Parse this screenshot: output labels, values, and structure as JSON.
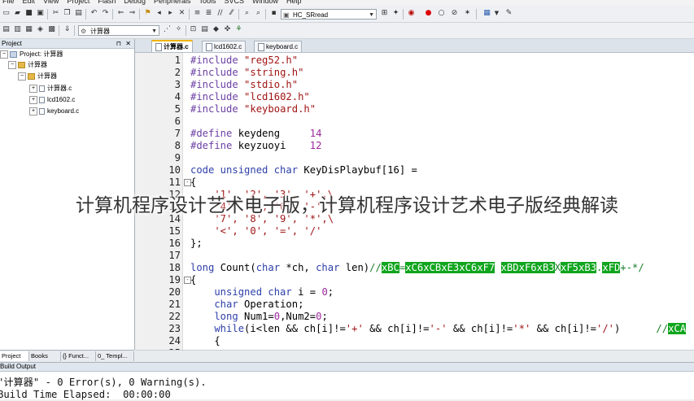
{
  "menu": [
    "File",
    "Edit",
    "View",
    "Project",
    "Flash",
    "Debug",
    "Peripherals",
    "Tools",
    "SVCS",
    "Window",
    "Help"
  ],
  "toolbar": {
    "target_combo": "HC_SRread",
    "target_select": "计算器"
  },
  "project_panel": {
    "title": "Project",
    "root": "Project: 计算器",
    "target": "计算器",
    "group": "计算器",
    "files": [
      "计算器.c",
      "lcd1602.c",
      "keyboard.c"
    ],
    "tabs": [
      "Project",
      "Books",
      "{} Funct...",
      "0_ Templ..."
    ]
  },
  "editor": {
    "tabs": [
      "计算器.c",
      "lcd1602.c",
      "keyboard.c"
    ],
    "active_tab": 0,
    "lines": [
      {
        "n": "1",
        "t": [
          [
            "pp",
            "#include "
          ],
          [
            "s",
            "\"reg52.h\""
          ]
        ]
      },
      {
        "n": "2",
        "t": [
          [
            "pp",
            "#include "
          ],
          [
            "s",
            "\"string.h\""
          ]
        ]
      },
      {
        "n": "3",
        "t": [
          [
            "pp",
            "#include "
          ],
          [
            "s",
            "\"stdio.h\""
          ]
        ]
      },
      {
        "n": "4",
        "t": [
          [
            "pp",
            "#include "
          ],
          [
            "s",
            "\"lcd1602.h\""
          ]
        ]
      },
      {
        "n": "5",
        "t": [
          [
            "pp",
            "#include "
          ],
          [
            "s",
            "\"keyboard.h\""
          ]
        ]
      },
      {
        "n": "6",
        "t": []
      },
      {
        "n": "7",
        "t": [
          [
            "pp",
            "#define "
          ],
          [
            "",
            "keydeng     "
          ],
          [
            "n",
            "14"
          ]
        ]
      },
      {
        "n": "8",
        "t": [
          [
            "pp",
            "#define "
          ],
          [
            "",
            "keyzuoyi    "
          ],
          [
            "n",
            "12"
          ]
        ]
      },
      {
        "n": "9",
        "t": []
      },
      {
        "n": "10",
        "t": [
          [
            "k",
            "code unsigned char "
          ],
          [
            "",
            "KeyDisPlaybuf[16] ="
          ]
        ]
      },
      {
        "n": "11",
        "fold": "-",
        "t": [
          [
            "",
            "{"
          ]
        ]
      },
      {
        "n": "12",
        "t": [
          [
            "s",
            "    '1', '2', '3', '+',\\"
          ]
        ]
      },
      {
        "n": "13",
        "t": [
          [
            "s",
            "    '4', '5', '6', '-',\\"
          ]
        ]
      },
      {
        "n": "14",
        "t": [
          [
            "s",
            "    '7', '8', '9', '*',\\"
          ]
        ]
      },
      {
        "n": "15",
        "t": [
          [
            "s",
            "    '<', '0', '=', '/'"
          ]
        ]
      },
      {
        "n": "16",
        "t": [
          [
            "",
            "};"
          ]
        ]
      },
      {
        "n": "17",
        "t": []
      },
      {
        "n": "18",
        "t": [
          [
            "k",
            "long "
          ],
          [
            "",
            "Count("
          ],
          [
            "k",
            "char "
          ],
          [
            "",
            "*ch, "
          ],
          [
            "k",
            "char "
          ],
          [
            "",
            "len)"
          ],
          [
            "c",
            "//"
          ],
          [
            "g",
            "xBC"
          ],
          [
            "c",
            "="
          ],
          [
            "g",
            "xC6xCBxE3xC6xF7"
          ],
          [
            "c",
            " "
          ],
          [
            "g",
            "xBDxF6xB3"
          ],
          [
            "c",
            "X"
          ],
          [
            "g",
            "xF5xB3"
          ],
          [
            "c",
            "."
          ],
          [
            "g",
            "xFD"
          ],
          [
            "c",
            "+-*/"
          ]
        ]
      },
      {
        "n": "19",
        "fold": "-",
        "t": [
          [
            "",
            "{"
          ]
        ]
      },
      {
        "n": "20",
        "t": [
          [
            "k",
            "    unsigned char "
          ],
          [
            "",
            "i = "
          ],
          [
            "n",
            "0"
          ],
          [
            "",
            ";"
          ]
        ]
      },
      {
        "n": "21",
        "t": [
          [
            "k",
            "    char "
          ],
          [
            "",
            "Operation;"
          ]
        ]
      },
      {
        "n": "22",
        "t": [
          [
            "k",
            "    long "
          ],
          [
            "",
            "Num1="
          ],
          [
            "n",
            "0"
          ],
          [
            "",
            ",Num2="
          ],
          [
            "n",
            "0"
          ],
          [
            "",
            ";"
          ]
        ]
      },
      {
        "n": "23",
        "t": [
          [
            "k",
            "    while"
          ],
          [
            "",
            "(i<len && ch[i]!="
          ],
          [
            "s",
            "'+'"
          ],
          [
            "",
            " && ch[i]!="
          ],
          [
            "s",
            "'-'"
          ],
          [
            "",
            " && ch[i]!="
          ],
          [
            "s",
            "'*'"
          ],
          [
            "",
            " && ch[i]!="
          ],
          [
            "s",
            "'/'"
          ],
          [
            "",
            ")      "
          ],
          [
            "c",
            "//"
          ],
          [
            "g",
            "xCA"
          ]
        ]
      },
      {
        "n": "24",
        "t": [
          [
            "",
            "    {"
          ]
        ]
      },
      {
        "n": "25",
        "t": [
          [
            "",
            "        ..."
          ]
        ]
      }
    ]
  },
  "build_output": {
    "title": "Build Output",
    "lines": [
      "\"计算器\" - 0 Error(s), 0 Warning(s).",
      "Build Time Elapsed:  00:00:00"
    ]
  },
  "overlay_caption": "计算机程序设计艺术电子版，计算机程序设计艺术电子版经典解读",
  "colors": {
    "keyword": "#2d3fa8",
    "preprocessor": "#6b3fa3",
    "string": "#a01414",
    "number": "#9c2a9c",
    "comment": "#1b7d2b",
    "highlight": "#10a51e"
  }
}
